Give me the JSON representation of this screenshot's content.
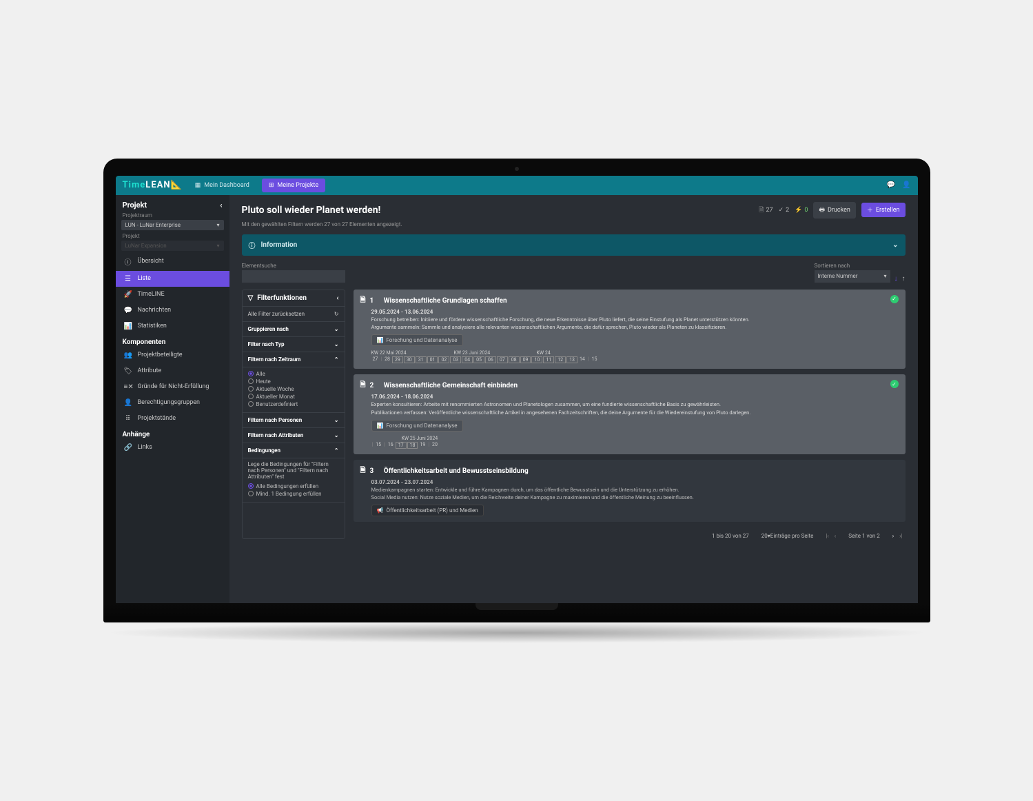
{
  "logo": {
    "part1": "Time",
    "part2": "LEAN"
  },
  "nav": {
    "dashboard": "Mein Dashboard",
    "projects": "Meine Projekte"
  },
  "sidebar": {
    "header": "Projekt",
    "roomLabel": "Projektraum",
    "roomValue": "LUN - LuNar Enterprise",
    "projectLabel": "Projekt",
    "projectValue": "LuNar Expansion",
    "items": {
      "overview": "Übersicht",
      "list": "Liste",
      "timeline": "TimeLINE",
      "messages": "Nachrichten",
      "stats": "Statistiken"
    },
    "components": {
      "header": "Komponenten",
      "participants": "Projektbeteiligte",
      "attributes": "Attribute",
      "reasons": "Gründe für Nicht-Erfüllung",
      "groups": "Berechtigungsgruppen",
      "states": "Projektstände"
    },
    "attachments": {
      "header": "Anhänge",
      "links": "Links"
    }
  },
  "main": {
    "title": "Pluto soll wieder Planet werden!",
    "counters": {
      "docs": "27",
      "checks": "2",
      "bolts": "0"
    },
    "printLabel": "Drucken",
    "createLabel": "Erstellen",
    "subtitle": "Mit den gewählten Filtern werden 27 von 27 Elementen angezeigt.",
    "infoBanner": "Information",
    "searchLabel": "Elementsuche",
    "sortLabel": "Sortieren nach",
    "sortValue": "Interne Nummer"
  },
  "filter": {
    "header": "Filterfunktionen",
    "reset": "Alle Filter zurücksetzen",
    "groupBy": "Gruppieren nach",
    "byType": "Filter nach Typ",
    "byTime": "Filtern nach Zeitraum",
    "timeOpts": {
      "all": "Alle",
      "today": "Heute",
      "week": "Aktuelle Woche",
      "month": "Aktueller Monat",
      "custom": "Benutzerdefiniert"
    },
    "byPerson": "Filtern nach Personen",
    "byAttr": "Filtern nach Attributen",
    "conditions": "Bedingungen",
    "condDesc": "Lege die Bedingungen für \"Filtern nach Personen\" und \"Filtern nach Attributen\" fest",
    "condAll": "Alle Bedingungen erfüllen",
    "condOne": "Mind. 1 Bedingung erfüllen"
  },
  "cards": [
    {
      "num": "1",
      "title": "Wissenschaftliche Grundlagen schaffen",
      "date": "29.05.2024 - 13.06.2024",
      "desc1": "Forschung betreiben: Initiiere und fördere wissenschaftliche Forschung, die neue Erkenntnisse über Pluto liefert, die seine Einstufung als Planet unterstützen könnten.",
      "desc2": "Argumente sammeln: Sammle und analysiere alle relevanten wissenschaftlichen Argumente, die dafür sprechen, Pluto wieder als Planeten zu klassifizieren.",
      "tag": "Forschung und Datenanalyse",
      "weeks": [
        "KW 22 Mai 2024",
        "KW 23 Juni 2024",
        "KW 24"
      ]
    },
    {
      "num": "2",
      "title": "Wissenschaftliche Gemeinschaft einbinden",
      "date": "17.06.2024 - 18.06.2024",
      "desc1": "Experten konsultieren: Arbeite mit renommierten Astronomen und Planetologen zusammen, um eine fundierte wissenschaftliche Basis zu gewährleisten.",
      "desc2": "Publikationen verfassen: Veröffentliche wissenschaftliche Artikel in angesehenen Fachzeitschriften, die deine Argumente für die Wiedereinstufung von Pluto darlegen.",
      "tag": "Forschung und Datenanalyse",
      "week": "KW 25 Juni 2024"
    },
    {
      "num": "3",
      "title": "Öffentlichkeitsarbeit und Bewusstseinsbildung",
      "date": "03.07.2024 - 23.07.2024",
      "desc1": "Medienkampagnen starten: Entwickle und führe Kampagnen durch, um das öffentliche Bewusstsein und die Unterstützung zu erhöhen.",
      "desc2": "Social Media nutzen: Nutze soziale Medien, um die Reichweite deiner Kampagne zu maximieren und die öffentliche Meinung zu beeinflussen.",
      "tag": "Öffentlichkeitsarbeit (PR) und Medien"
    }
  ],
  "pagination": {
    "range": "1 bis 20 von 27",
    "perPage": "20▾Einträge pro Seite",
    "page": "Seite 1 von 2"
  }
}
